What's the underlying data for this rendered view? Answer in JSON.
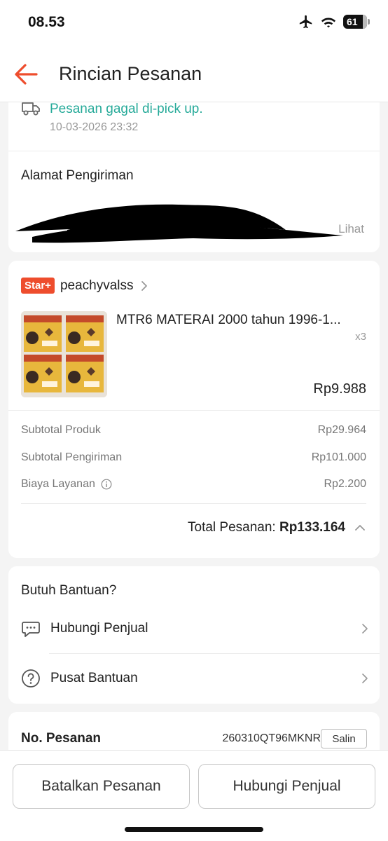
{
  "status_bar": {
    "time": "08.53",
    "battery": "61",
    "icons": [
      "airplane-icon",
      "wifi-icon",
      "battery-icon"
    ]
  },
  "header": {
    "title": "Rincian Pesanan",
    "back_icon": "arrow-left-icon"
  },
  "shipment": {
    "status": "Pesanan gagal di-pick up.",
    "time": "10-03-2026 23:32",
    "icon": "truck-icon"
  },
  "address": {
    "title": "Alamat Pengiriman",
    "link": "Lihat"
  },
  "shop": {
    "badge": "Star+",
    "name": "peachyvalss"
  },
  "product": {
    "name": "MTR6 MATERAI 2000 tahun 1996-1...",
    "qty": "x3",
    "price": "Rp9.988"
  },
  "summary": {
    "rows": [
      {
        "label": "Subtotal Produk",
        "value": "Rp29.964"
      },
      {
        "label": "Subtotal Pengiriman",
        "value": "Rp101.000"
      },
      {
        "label": "Biaya Layanan",
        "value": "Rp2.200"
      }
    ],
    "total_label": "Total Pesanan:",
    "total_value": "Rp133.164"
  },
  "help": {
    "title": "Butuh Bantuan?",
    "items": [
      {
        "label": "Hubungi Penjual",
        "icon": "chat-icon"
      },
      {
        "label": "Pusat Bantuan",
        "icon": "question-circle-icon"
      }
    ]
  },
  "order": {
    "label": "No. Pesanan",
    "number": "260310QT96MKNR",
    "copy_label": "Salin"
  },
  "actions": {
    "cancel_label": "Batalkan Pesanan",
    "contact_label": "Hubungi Penjual"
  },
  "colors": {
    "accent": "#ee4d2d",
    "status_green": "#26aa99"
  }
}
